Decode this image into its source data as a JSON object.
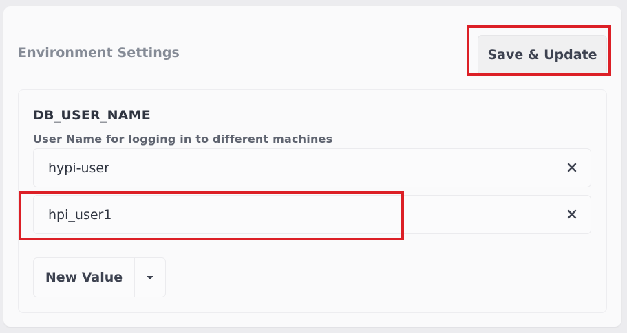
{
  "section": {
    "title": "Environment Settings"
  },
  "toolbar": {
    "save_label": "Save & Update"
  },
  "variable": {
    "name": "DB_USER_NAME",
    "description": "User Name for logging in to different machines",
    "values": [
      {
        "value": "hypi-user"
      },
      {
        "value": "hpi_user1"
      }
    ]
  },
  "actions": {
    "new_value_label": "New Value"
  },
  "icons": {
    "remove": "close-icon",
    "dropdown": "caret-down-icon"
  },
  "colors": {
    "highlight": "#dc1f26",
    "text_primary": "#2f3440",
    "text_muted": "#858b96"
  }
}
